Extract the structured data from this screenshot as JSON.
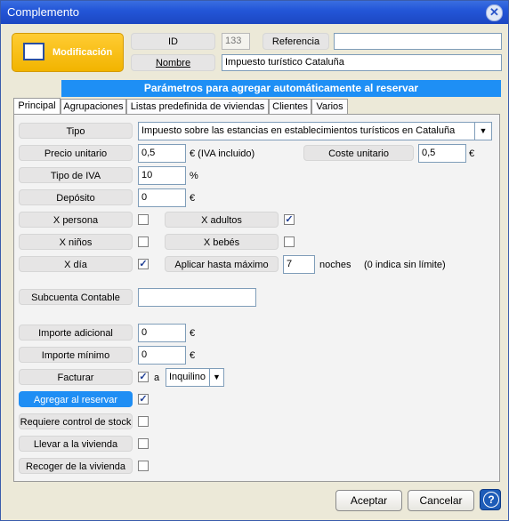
{
  "window": {
    "title": "Complemento",
    "close_icon": "close-icon"
  },
  "header": {
    "mode_label": "Modificación",
    "id_label": "ID",
    "id_value": "133",
    "referencia_label": "Referencia",
    "referencia_value": "",
    "nombre_label": "Nombre",
    "nombre_value": "Impuesto turístico Cataluña"
  },
  "banner": "Parámetros para agregar automáticamente al reservar",
  "tabs": [
    "Principal",
    "Agrupaciones",
    "Listas predefinida de viviendas",
    "Clientes",
    "Varios"
  ],
  "form": {
    "tipo_label": "Tipo",
    "tipo_value": "Impuesto sobre las estancias en establecimientos turísticos en Cataluña",
    "precio_label": "Precio unitario",
    "precio_value": "0,5",
    "precio_suffix": "€ (IVA incluido)",
    "coste_label": "Coste unitario",
    "coste_value": "0,5",
    "coste_suffix": "€",
    "iva_label": "Tipo de IVA",
    "iva_value": "10",
    "iva_suffix": "%",
    "deposito_label": "Depósito",
    "deposito_value": "0",
    "deposito_suffix": "€",
    "xpersona_label": "X persona",
    "xpersona_checked": false,
    "xadultos_label": "X adultos",
    "xadultos_checked": true,
    "xninos_label": "X niños",
    "xninos_checked": false,
    "xbebes_label": "X bebés",
    "xbebes_checked": false,
    "xdia_label": "X día",
    "xdia_checked": true,
    "aplicar_label": "Aplicar hasta máximo",
    "aplicar_value": "7",
    "aplicar_suffix": "noches",
    "aplicar_note": "(0 indica sin límite)",
    "subcuenta_label": "Subcuenta Contable",
    "subcuenta_value": "",
    "importe_adicional_label": "Importe adicional",
    "importe_adicional_value": "0",
    "importe_adicional_suffix": "€",
    "importe_minimo_label": "Importe mínimo",
    "importe_minimo_value": "0",
    "importe_minimo_suffix": "€",
    "facturar_label": "Facturar",
    "facturar_checked": true,
    "facturar_a": "a",
    "facturar_select": "Inquilino",
    "agregar_label": "Agregar al reservar",
    "agregar_checked": true,
    "stock_label": "Requiere control de stock",
    "stock_checked": false,
    "llevar_label": "Llevar a la vivienda",
    "llevar_checked": false,
    "recoger_label": "Recoger de la vivienda",
    "recoger_checked": false
  },
  "footer": {
    "aceptar": "Aceptar",
    "cancelar": "Cancelar",
    "help": "?"
  },
  "colors": {
    "title_bar": "#2356d8",
    "banner": "#1e8ff5",
    "mode_button": "#f2b400"
  }
}
